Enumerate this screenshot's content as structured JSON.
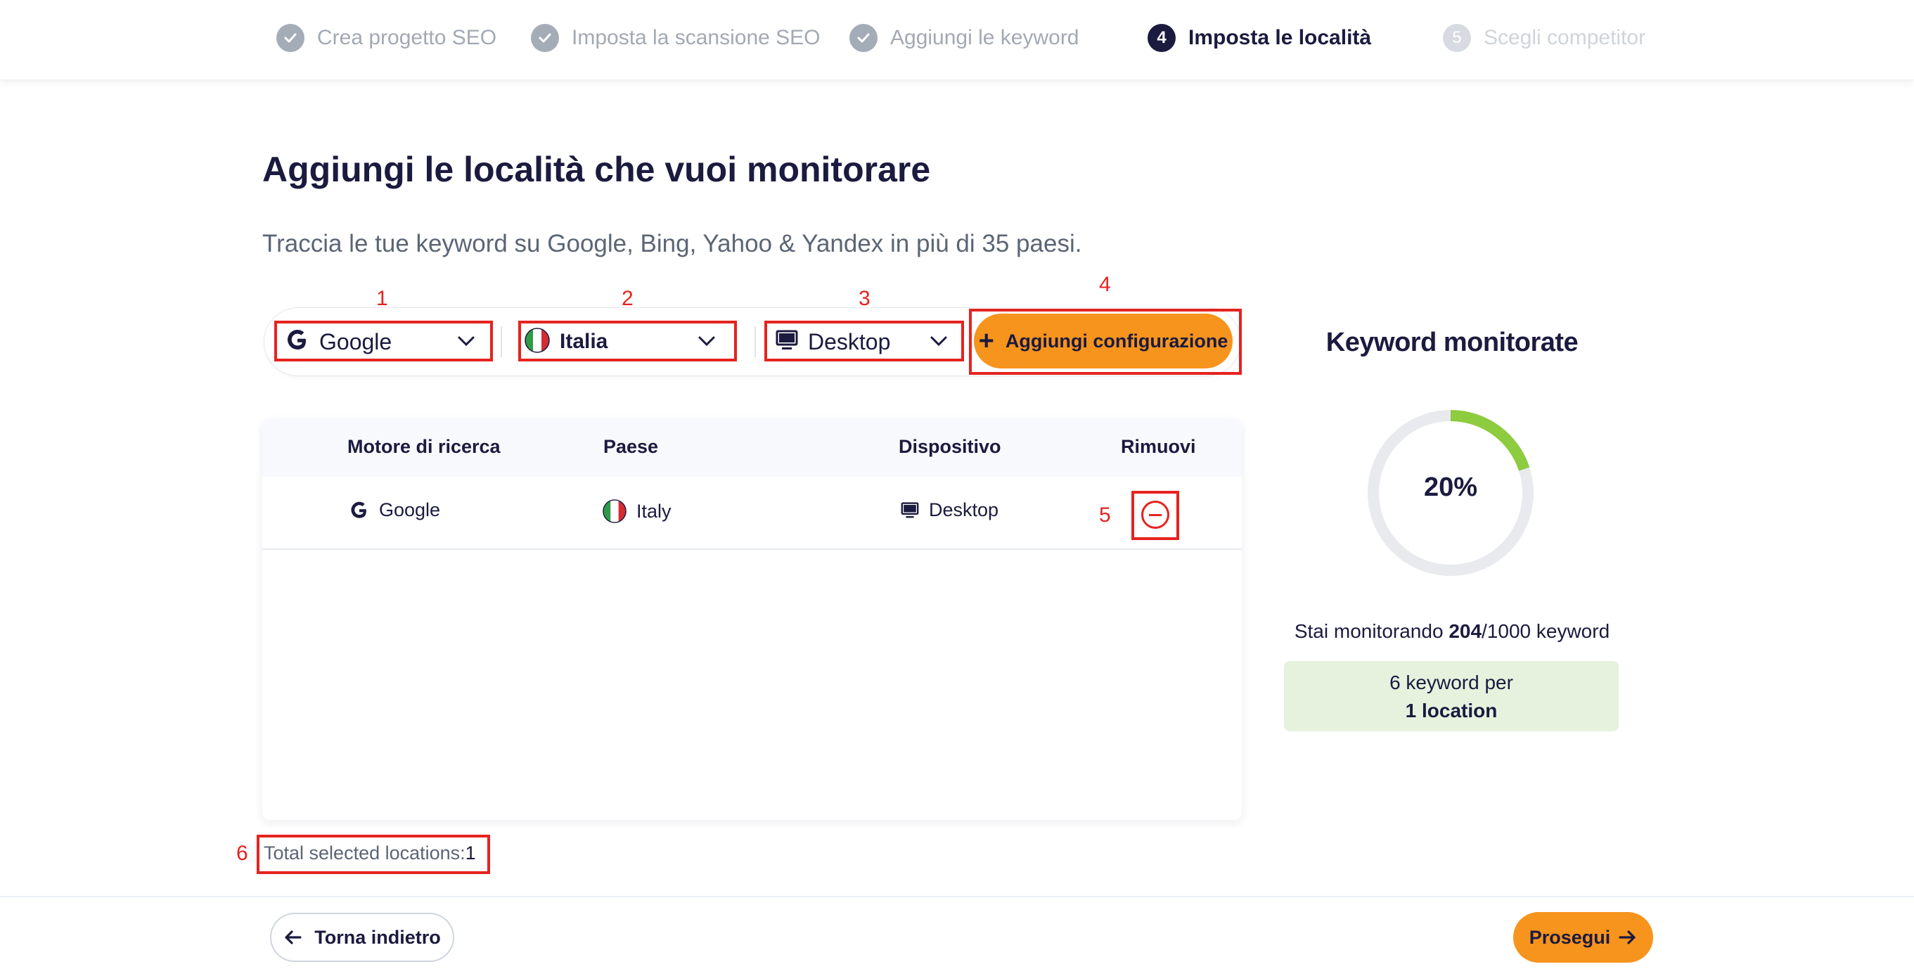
{
  "stepper": {
    "steps": [
      {
        "label": "Crea progetto SEO",
        "state": "done"
      },
      {
        "label": "Imposta la scansione SEO",
        "state": "done"
      },
      {
        "label": "Aggiungi le keyword",
        "state": "done"
      },
      {
        "number": "4",
        "label": "Imposta le località",
        "state": "active"
      },
      {
        "number": "5",
        "label": "Scegli competitor",
        "state": "future"
      }
    ]
  },
  "main": {
    "title": "Aggiungi le località che vuoi monitorare",
    "subtitle": "Traccia le tue keyword su Google, Bing, Yahoo & Yandex in più di 35 paesi."
  },
  "toolbar": {
    "engine": {
      "value": "Google",
      "icon": "google-g-icon"
    },
    "country": {
      "value": "Italia",
      "icon": "italy-flag-icon"
    },
    "device": {
      "value": "Desktop",
      "icon": "desktop-icon"
    },
    "add_label": "Aggiungi configurazione"
  },
  "annotations": [
    "1",
    "2",
    "3",
    "4",
    "5",
    "6"
  ],
  "table": {
    "headers": [
      "Motore di ricerca",
      "Paese",
      "Dispositivo",
      "Rimuovi"
    ],
    "rows": [
      {
        "engine": "Google",
        "country": "Italy",
        "device": "Desktop"
      }
    ]
  },
  "total": {
    "label": "Total selected locations:",
    "value": "1"
  },
  "keywords_panel": {
    "title": "Keyword monitorate",
    "percent": "20%",
    "percent_value": 0.2,
    "monitoring_prefix": "Stai monitorando ",
    "used": "204",
    "limit": "/1000 keyword",
    "per_line1": "6 keyword per",
    "per_line2": "1 location",
    "ring_color": "#8dcb3f",
    "track_color": "#e8eaed"
  },
  "footer": {
    "back_label": "Torna indietro",
    "next_label": "Prosegui"
  },
  "colors": {
    "accent": "#f7941d",
    "navy": "#1b1a3f",
    "annotation_red": "#e5231f"
  }
}
